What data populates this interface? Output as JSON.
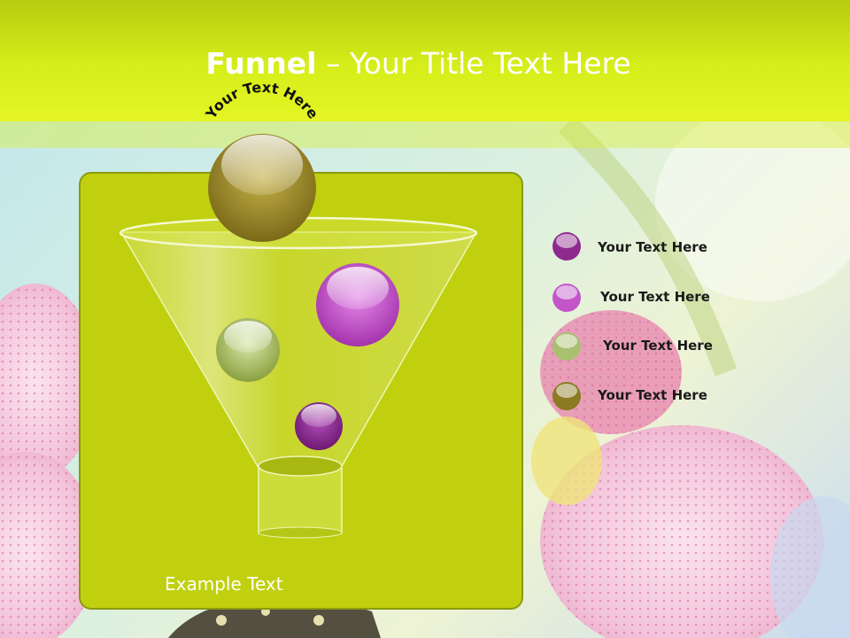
{
  "slide": {
    "title_bold": "Funnel",
    "title_rest": " – Your Title Text Here",
    "arc_text": "Your Text Here",
    "example_text": "Example Text"
  },
  "legend": [
    {
      "label": "Your  Text Here",
      "color": "#8e2a8e"
    },
    {
      "label": "Your  Text Here",
      "color": "#c255c8"
    },
    {
      "label": "Your  Text Here",
      "color": "#a8c070"
    },
    {
      "label": "Your  Text Here",
      "color": "#8a7a20"
    }
  ],
  "colors": {
    "header": "#d6ee1a",
    "panel": "#c0d00e",
    "panel_border": "#8a9a10"
  }
}
